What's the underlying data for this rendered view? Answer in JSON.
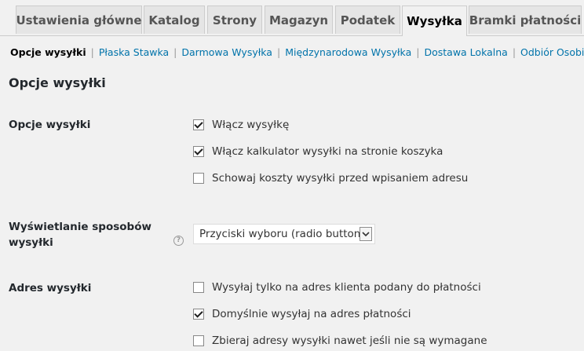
{
  "tabs": [
    {
      "label": "Ustawienia główne",
      "active": false
    },
    {
      "label": "Katalog",
      "active": false
    },
    {
      "label": "Strony",
      "active": false
    },
    {
      "label": "Magazyn",
      "active": false
    },
    {
      "label": "Podatek",
      "active": false
    },
    {
      "label": "Wysyłka",
      "active": true
    },
    {
      "label": "Bramki płatności",
      "active": false
    }
  ],
  "subnav": {
    "current": "Opcje wysyłki",
    "links": [
      "Płaska Stawka",
      "Darmowa Wysyłka",
      "Międzynarodowa Wysyłka",
      "Dostawa Lokalna",
      "Odbiór Osobisty"
    ],
    "separator": "|"
  },
  "section_title": "Opcje wysyłki",
  "shipping_options": {
    "label": "Opcje wysyłki",
    "items": [
      {
        "label": "Włącz wysyłkę",
        "checked": true
      },
      {
        "label": "Włącz kalkulator wysyłki na stronie koszyka",
        "checked": true
      },
      {
        "label": "Schowaj koszty wysyłki przed wpisaniem adresu",
        "checked": false
      }
    ]
  },
  "display_methods": {
    "label_line1": "Wyświetlanie sposobów",
    "label_line2": "wysyłki",
    "help_icon": "question-circle-icon",
    "help_glyph": "?",
    "select_value": "Przyciski wyboru (radio button)",
    "dropdown_icon": "chevron-down-icon"
  },
  "shipping_address": {
    "label": "Adres wysyłki",
    "items": [
      {
        "label": "Wysyłaj tylko na adres klienta podany do płatności",
        "checked": false
      },
      {
        "label": "Domyślnie wysyłaj na adres płatności",
        "checked": true
      },
      {
        "label": "Zbieraj adresy wysyłki nawet jeśli nie są wymagane",
        "checked": false
      }
    ]
  },
  "colors": {
    "background": "#f1f1f1",
    "tab_inactive": "#e5e5e5",
    "link": "#0073aa",
    "text": "#23282d"
  }
}
